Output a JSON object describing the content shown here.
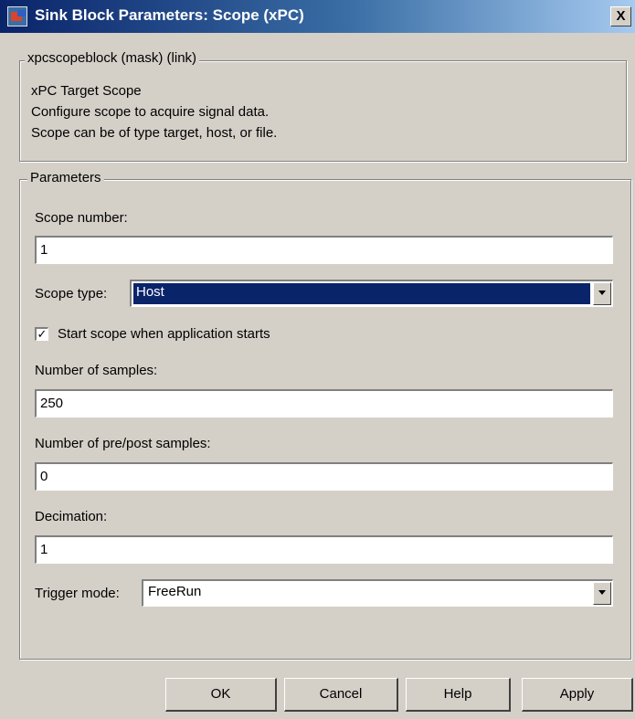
{
  "window": {
    "title": "Sink Block Parameters: Scope (xPC)",
    "close_label": "X",
    "icon": "simulink-block-icon"
  },
  "mask_group": {
    "label": "xpcscopeblock (mask) (link)",
    "description_lines": [
      "xPC Target Scope",
      "Configure scope to acquire signal data.",
      "Scope can be of type target, host, or file."
    ]
  },
  "parameters": {
    "label": "Parameters",
    "scope_number": {
      "label": "Scope number:",
      "value": "1"
    },
    "scope_type": {
      "label": "Scope type:",
      "value": "Host"
    },
    "start_scope": {
      "label": "Start scope when application starts",
      "checked": true
    },
    "number_of_samples": {
      "label": "Number of samples:",
      "value": "250"
    },
    "pre_post_samples": {
      "label": "Number of pre/post samples:",
      "value": "0"
    },
    "decimation": {
      "label": "Decimation:",
      "value": "1"
    },
    "trigger_mode": {
      "label": "Trigger mode:",
      "value": "FreeRun"
    }
  },
  "buttons": {
    "ok": "OK",
    "cancel": "Cancel",
    "help": "Help",
    "apply": "Apply"
  },
  "colors": {
    "title_gradient_start": "#0a246a",
    "title_gradient_end": "#a6caf0",
    "dialog_background": "#d4d0c8",
    "selection": "#0a246a"
  }
}
